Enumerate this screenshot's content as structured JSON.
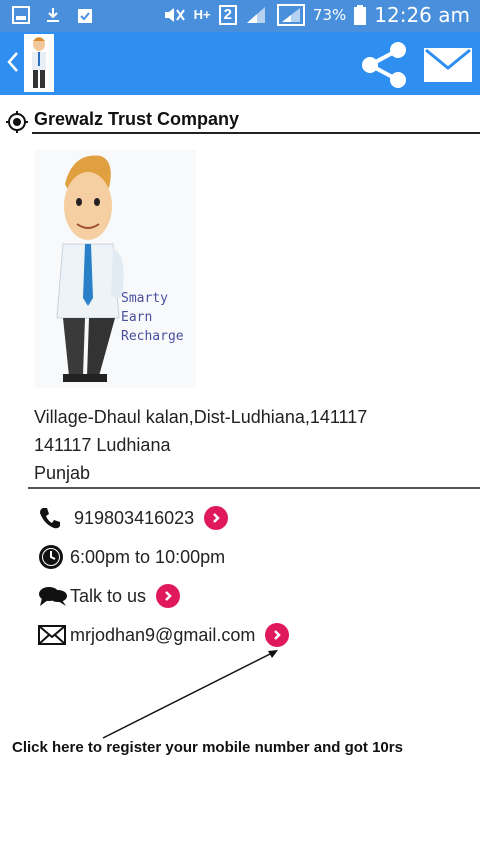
{
  "status_bar": {
    "battery": "73%",
    "time": "12:26 am",
    "network": "H+",
    "sim": "2"
  },
  "app_bar": {
    "icons": [
      "back-icon",
      "app-logo",
      "share-icon",
      "mail-icon"
    ]
  },
  "company": {
    "name": "Grewalz Trust Company"
  },
  "illustration": {
    "lines": [
      "Smarty",
      "Earn",
      "Recharge"
    ]
  },
  "address": {
    "line1": "Village-Dhaul kalan,Dist-Ludhiana,141117",
    "line2": "141117 Ludhiana",
    "line3": "Punjab"
  },
  "contacts": {
    "phone": "919803416023",
    "hours": "6:00pm to 10:00pm",
    "chat": "Talk to us",
    "email": "mrjodhan9@gmail.com"
  },
  "footer": {
    "note": "Click here to register your mobile number and got 10rs"
  },
  "colors": {
    "status_bar": "#4a8fdc",
    "app_bar": "#2f8ff0",
    "go_button": "#e0195c"
  }
}
